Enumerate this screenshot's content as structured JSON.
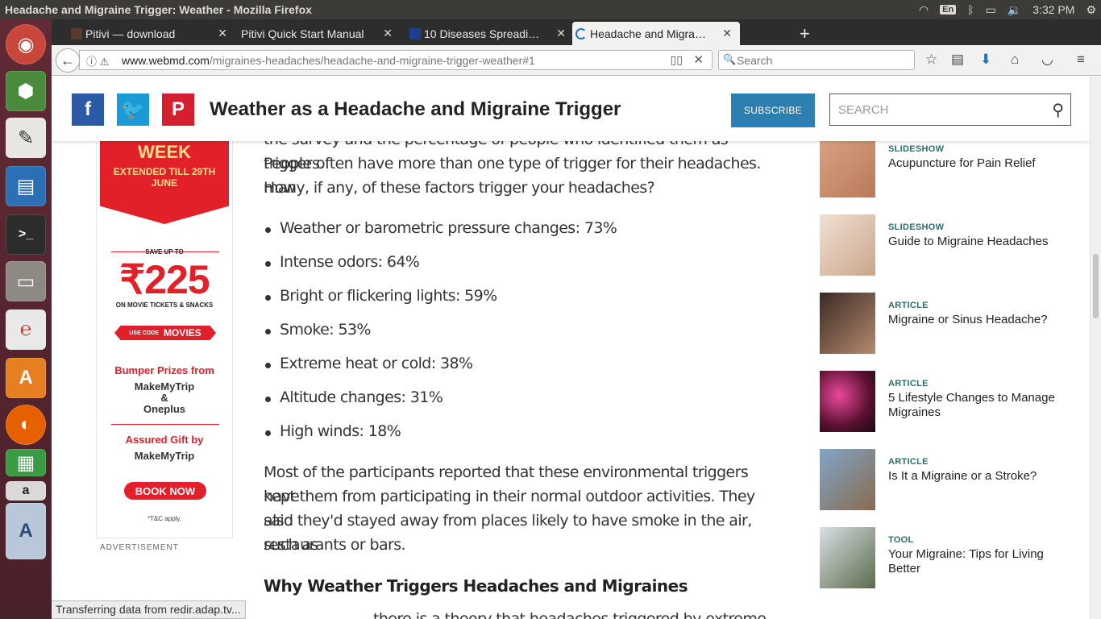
{
  "system": {
    "window_title": "Headache and Migraine Trigger: Weather - Mozilla Firefox",
    "keyboard_layout": "En",
    "clock": "3:32 PM"
  },
  "browser": {
    "tabs": [
      {
        "title": "Pitivi — download"
      },
      {
        "title": "Pitivi Quick Start Manual"
      },
      {
        "title": "10 Diseases Spreadi…"
      },
      {
        "title": "Headache and Migra…"
      }
    ],
    "url_host": "www.webmd.com",
    "url_path": "/migraines-headaches/headache-and-migraine-trigger-weather#1",
    "search_placeholder": "Search",
    "status_text": "Transferring data from redir.adap.tv..."
  },
  "header": {
    "headline": "Weather as a Headache and Migraine Trigger",
    "subscribe_label": "SUBSCRIBE",
    "search_placeholder": "SEARCH"
  },
  "ad": {
    "week": "WEEK",
    "extended": "EXTENDED TILL 29TH JUNE",
    "save": "SAVE UP TO",
    "price": "₹225",
    "tickets": "ON MOVIE TICKETS & SNACKS",
    "code_prefix": "USE CODE",
    "code": "MOVIES",
    "bumper": "Bumper Prizes from",
    "bumper_brand1": "MakeMyTrip",
    "amp": "&",
    "bumper_brand2": "Oneplus",
    "assured": "Assured Gift by",
    "assured_brand": "MakeMyTrip",
    "book": "BOOK NOW",
    "tc": "*T&C apply.",
    "label": "ADVERTISEMENT"
  },
  "article": {
    "intro_partial": "the survey and the percentage of people who identified them as triggers.",
    "intro_line2": "People often have more than one type of trigger for their headaches. How",
    "intro_line3": "many, if any, of these factors trigger your headaches?",
    "triggers": [
      "Weather or barometric pressure changes: 73%",
      "Intense odors: 64%",
      "Bright or flickering lights: 59%",
      "Smoke: 53%",
      "Extreme heat or cold: 38%",
      "Altitude changes: 31%",
      "High winds: 18%"
    ],
    "para2_line1": "Most of the participants reported that these environmental triggers have",
    "para2_line2": "kept them from participating in their normal outdoor activities. They also",
    "para2_line3": "said they'd stayed away from places likely to have smoke in the air, such as",
    "para2_line4": "restaurants or bars.",
    "section_heading": "Why Weather Triggers Headaches and Migraines",
    "para3_partial": "there is a theory that headaches triggered by extreme"
  },
  "sidebar": [
    {
      "type": "SLIDESHOW",
      "title": "Acupuncture for Pain Relief"
    },
    {
      "type": "SLIDESHOW",
      "title": "Guide to Migraine Headaches"
    },
    {
      "type": "ARTICLE",
      "title": "Migraine or Sinus Headache?"
    },
    {
      "type": "ARTICLE",
      "title": "5 Lifestyle Changes to Manage Migraines"
    },
    {
      "type": "ARTICLE",
      "title": "Is It a Migraine or a Stroke?"
    },
    {
      "type": "TOOL",
      "title": "Your Migraine: Tips for Living Better"
    }
  ],
  "colors": {
    "facebook": "#2d5aa6",
    "twitter": "#1a9bd7",
    "pinterest": "#d4202e",
    "subscribe": "#2e7fb1",
    "sidebar_type": "#2b6e6e"
  }
}
